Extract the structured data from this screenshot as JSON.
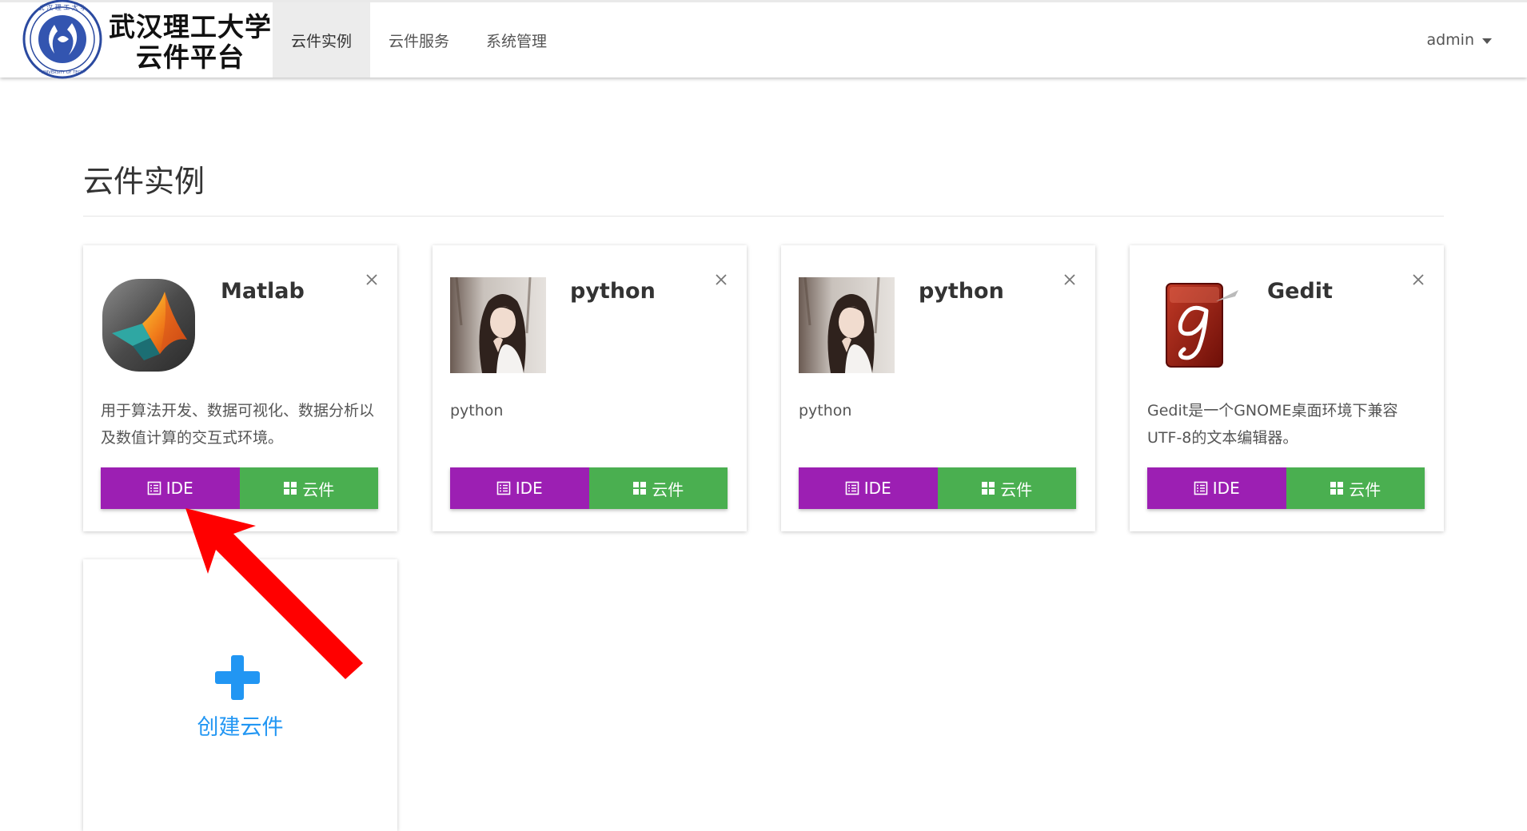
{
  "header": {
    "brand_line1": "武汉理工大学",
    "brand_line2": "云件平台",
    "nav": [
      {
        "label": "云件实例",
        "active": true
      },
      {
        "label": "云件服务",
        "active": false
      },
      {
        "label": "系统管理",
        "active": false
      }
    ],
    "user": "admin"
  },
  "main": {
    "title": "云件实例",
    "cards": [
      {
        "title": "Matlab",
        "description": "用于算法开发、数据可视化、数据分析以及数值计算的交互式环境。",
        "thumb_icon": "matlab-logo-icon",
        "ide_label": "IDE",
        "cloud_label": "云件"
      },
      {
        "title": "python",
        "description": "python",
        "thumb_icon": "portrait-photo",
        "ide_label": "IDE",
        "cloud_label": "云件"
      },
      {
        "title": "python",
        "description": "python",
        "thumb_icon": "portrait-photo",
        "ide_label": "IDE",
        "cloud_label": "云件"
      },
      {
        "title": "Gedit",
        "description": "Gedit是一个GNOME桌面环境下兼容UTF-8的文本编辑器。",
        "thumb_icon": "gedit-logo-icon",
        "ide_label": "IDE",
        "cloud_label": "云件"
      }
    ],
    "create": {
      "label": "创建云件"
    }
  },
  "colors": {
    "ide_button": "#9c1fb3",
    "cloud_button": "#4aaf50",
    "create_accent": "#2196f3",
    "annotation_arrow": "#ff0000"
  }
}
